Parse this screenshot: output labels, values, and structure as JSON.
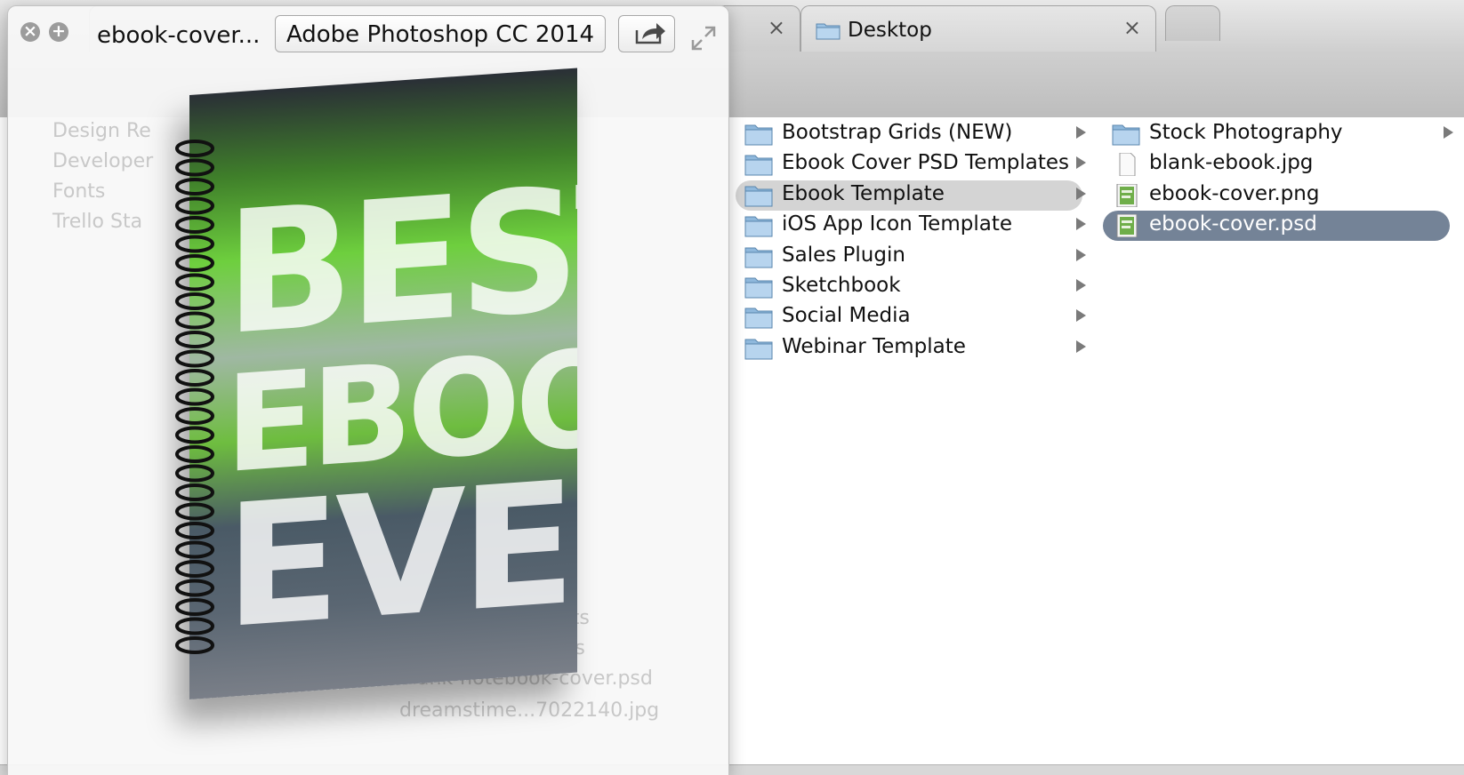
{
  "finder": {
    "tabs": [
      {
        "label": "",
        "close": "×"
      },
      {
        "label": "Desktop",
        "close": "×"
      },
      {
        "label": ""
      }
    ],
    "columns": [
      {
        "items": [
          {
            "label": "Bootstrap Grids (NEW)",
            "type": "folder",
            "has_children": true,
            "selected": "none"
          },
          {
            "label": "Ebook Cover PSD Templates",
            "type": "folder",
            "has_children": true,
            "selected": "none"
          },
          {
            "label": "Ebook Template",
            "type": "folder",
            "has_children": true,
            "selected": "inactive"
          },
          {
            "label": "iOS App Icon Template",
            "type": "folder",
            "has_children": true,
            "selected": "none"
          },
          {
            "label": "Sales Plugin",
            "type": "folder",
            "has_children": true,
            "selected": "none"
          },
          {
            "label": "Sketchbook",
            "type": "folder",
            "has_children": true,
            "selected": "none"
          },
          {
            "label": "Social Media",
            "type": "folder",
            "has_children": true,
            "selected": "none"
          },
          {
            "label": "Webinar Template",
            "type": "folder",
            "has_children": true,
            "selected": "none"
          }
        ]
      },
      {
        "items": [
          {
            "label": "Stock Photography",
            "type": "folder",
            "has_children": true,
            "selected": "none"
          },
          {
            "label": "blank-ebook.jpg",
            "type": "file-blank",
            "has_children": false,
            "selected": "none"
          },
          {
            "label": "ebook-cover.png",
            "type": "file-image",
            "has_children": false,
            "selected": "none"
          },
          {
            "label": "ebook-cover.psd",
            "type": "file-image",
            "has_children": false,
            "selected": "active"
          }
        ]
      }
    ]
  },
  "quicklook": {
    "title": "ebook-cover...",
    "open_with_button": "Adobe Photoshop CC 2014",
    "close_symbol": "×",
    "fullscreen_symbol": "+",
    "preview": {
      "line1": "BEST",
      "line2": "EBOOK",
      "line3": "EVER"
    }
  },
  "colors": {
    "selection_active": "#748397",
    "selection_inactive": "#d4d4d4",
    "folder_blue": "#8fb8dc"
  }
}
